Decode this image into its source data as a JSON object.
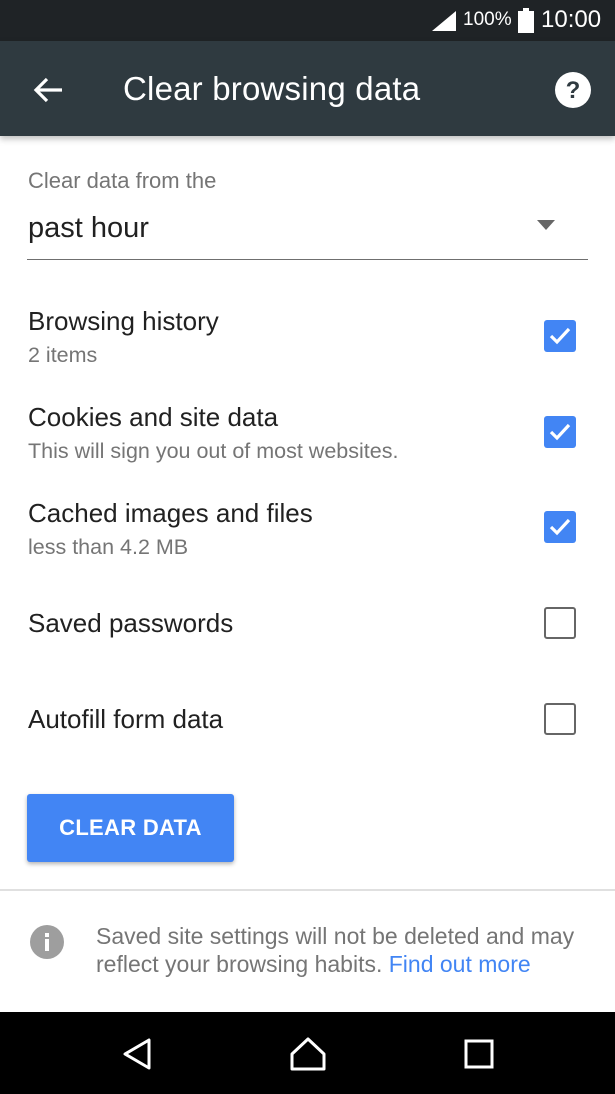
{
  "status_bar": {
    "battery_percent": "100%",
    "time": "10:00",
    "icons": [
      "signal-icon",
      "battery-icon"
    ]
  },
  "app_bar": {
    "title": "Clear browsing data",
    "icons": [
      "back-arrow-icon",
      "help-icon"
    ]
  },
  "time_range": {
    "label": "Clear data from the",
    "selected": "past hour"
  },
  "options": [
    {
      "label": "Browsing history",
      "detail": "2 items",
      "checked": true
    },
    {
      "label": "Cookies and site data",
      "detail": "This will sign you out of most websites.",
      "checked": true
    },
    {
      "label": "Cached images and files",
      "detail": "less than 4.2 MB",
      "checked": true
    },
    {
      "label": "Saved passwords",
      "detail": "",
      "checked": false
    },
    {
      "label": "Autofill form data",
      "detail": "",
      "checked": false
    }
  ],
  "clear_button": {
    "label": "CLEAR DATA"
  },
  "footer": {
    "text": "Saved site settings will not be deleted and may reflect your browsing habits.",
    "link": "Find out more"
  },
  "nav_bar": {
    "icons": [
      "back-triangle-icon",
      "home-icon",
      "recents-icon"
    ]
  },
  "colors": {
    "accent": "#4285f4",
    "app_bar": "#2f3a40",
    "status_bar": "#1f2326"
  }
}
